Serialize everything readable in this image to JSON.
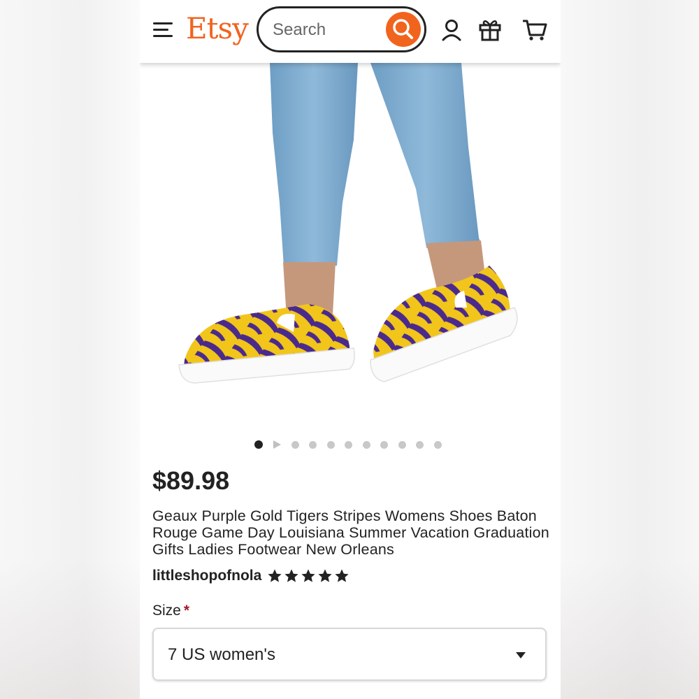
{
  "header": {
    "logo": "Etsy",
    "search_placeholder": "Search",
    "icons": [
      "menu-icon",
      "search-icon",
      "account-icon",
      "gift-icon",
      "cart-icon"
    ]
  },
  "colors": {
    "brand": "#f1641e",
    "text": "#222222",
    "required": "#a61a2e"
  },
  "carousel": {
    "image_count": 10,
    "active_index": 0,
    "has_video": true
  },
  "product": {
    "price": "$89.98",
    "title": "Geaux Purple Gold Tigers Stripes Womens Shoes Baton Rouge Game Day Louisiana Summer Vacation Graduation Gifts Ladies Footwear New Orleans",
    "shop_name": "littleshopofnola",
    "rating_stars": 5
  },
  "options": {
    "size_label": "Size",
    "required_mark": "*",
    "size_value": "7 US women's"
  }
}
